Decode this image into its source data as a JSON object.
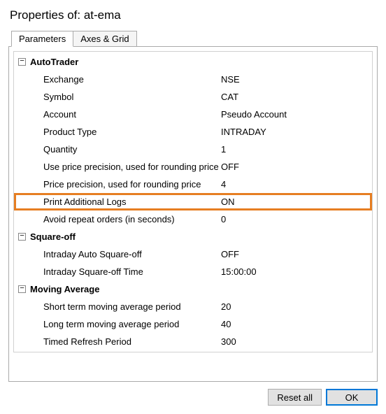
{
  "title": "Properties of: at-ema",
  "tabs": {
    "parameters": "Parameters",
    "axesgrid": "Axes & Grid"
  },
  "groups": {
    "autotrader": {
      "name": "AutoTrader",
      "rows": {
        "exchange": {
          "label": "Exchange",
          "value": "NSE"
        },
        "symbol": {
          "label": "Symbol",
          "value": "CAT"
        },
        "account": {
          "label": "Account",
          "value": "Pseudo Account"
        },
        "product_type": {
          "label": "Product Type",
          "value": "INTRADAY"
        },
        "quantity": {
          "label": "Quantity",
          "value": "1"
        },
        "use_price_precision": {
          "label": "Use price precision, used for rounding price",
          "value": "OFF"
        },
        "price_precision": {
          "label": "Price precision, used for rounding price",
          "value": "4"
        },
        "print_logs": {
          "label": "Print Additional Logs",
          "value": "ON"
        },
        "avoid_repeat": {
          "label": "Avoid repeat orders (in seconds)",
          "value": "0"
        }
      }
    },
    "squareoff": {
      "name": "Square-off",
      "rows": {
        "auto_sqoff": {
          "label": "Intraday Auto Square-off",
          "value": "OFF"
        },
        "sqoff_time": {
          "label": "Intraday Square-off Time",
          "value": "15:00:00"
        }
      }
    },
    "moving_average": {
      "name": "Moving Average",
      "rows": {
        "short_ma": {
          "label": "Short term moving average period",
          "value": "20"
        },
        "long_ma": {
          "label": "Long term moving average period",
          "value": "40"
        },
        "refresh": {
          "label": "Timed Refresh Period",
          "value": "300"
        }
      }
    }
  },
  "buttons": {
    "reset_all": "Reset all",
    "ok": "OK"
  },
  "expander_symbol": "−"
}
